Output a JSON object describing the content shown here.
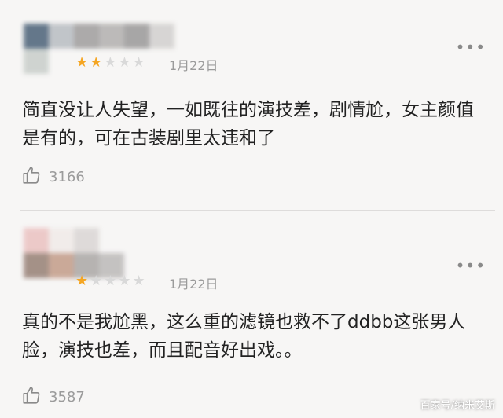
{
  "comments": [
    {
      "rating_filled": "★★",
      "rating_empty": "★★★",
      "rating": 2,
      "rating_max": 5,
      "date": "1月22日",
      "text": "简直没让人失望，一如既往的演技差，剧情尬，女主颜值是有的，可在古装剧里太违和了",
      "likes": "3166"
    },
    {
      "rating_filled": "★",
      "rating_empty": "★★★★",
      "rating": 1,
      "rating_max": 5,
      "date": "1月22日",
      "text": "真的不是我尬黑，这么重的滤镜也救不了ddbb这张男人脸，演技也差，而且配音好出戏。。",
      "likes": "3587"
    }
  ],
  "more_glyph": "•••",
  "watermark": "百家号/纳米艾斯",
  "colors": {
    "star_on": "#f5a623",
    "star_off": "#d9d9d9",
    "background": "#f7f6f5"
  },
  "icons": {
    "like": "thumbs-up-icon",
    "more": "more-dots-icon"
  }
}
